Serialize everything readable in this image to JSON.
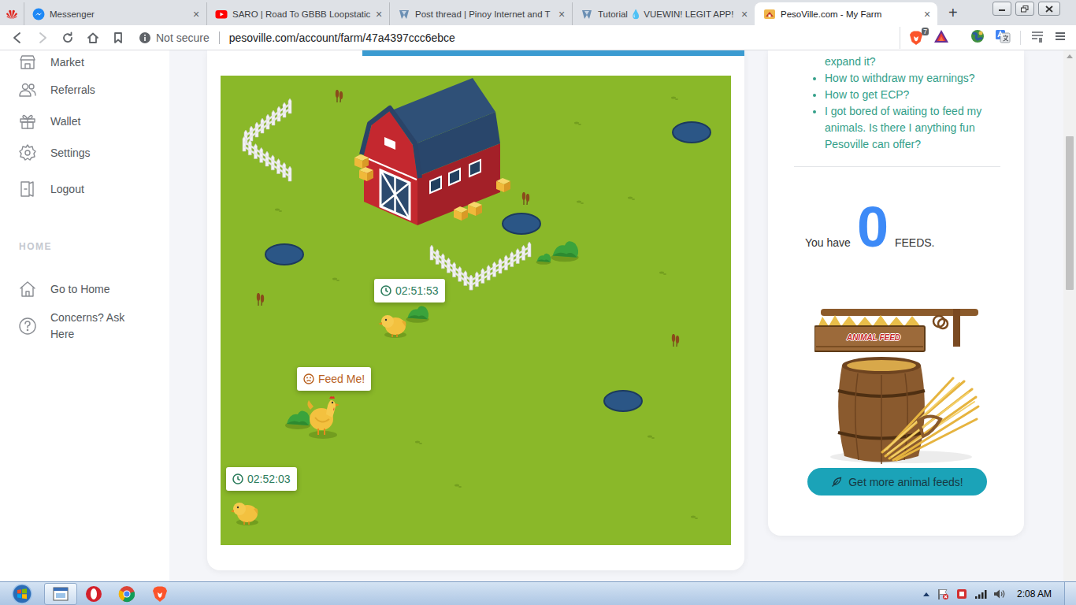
{
  "browser": {
    "tabs": [
      {
        "label": "Messenger",
        "selected": false
      },
      {
        "label": "SARO | Road To GBBB Loopstatic",
        "selected": false
      },
      {
        "label": "Post thread | Pinoy Internet and T",
        "selected": false
      },
      {
        "label": "Tutorial 💧 VUEWIN! LEGIT APP!",
        "selected": false
      },
      {
        "label": "PesoVille.com - My Farm",
        "selected": true
      }
    ],
    "tab_close": "×",
    "new_tab": "+",
    "security": "Not secure",
    "url": "pesoville.com/account/farm/47a4397ccc6ebce",
    "extension_badge": "7"
  },
  "sidebar": {
    "items": [
      "Market",
      "Referrals",
      "Wallet",
      "Settings",
      "Logout"
    ],
    "section": "HOME",
    "home_items": [
      "Go to Home",
      "Concerns? Ask Here"
    ]
  },
  "farm": {
    "animals": [
      {
        "kind": "chick",
        "hungry": false,
        "label": "02:51:53"
      },
      {
        "kind": "hen",
        "hungry": true,
        "label": "Feed Me!"
      },
      {
        "kind": "chick",
        "hungry": false,
        "label": "02:52:03"
      }
    ]
  },
  "help": {
    "cut_line": "expand it?",
    "links": [
      "How to withdraw my earnings?",
      "How to get ECP?",
      "I got bored of waiting to feed my animals. Is there I anything fun Pesoville can offer?"
    ]
  },
  "feeds": {
    "prefix": "You have",
    "count": "0",
    "suffix": "FEEDS."
  },
  "feed_sign": "ANIMAL FEED",
  "feed_button": "Get more animal feeds!",
  "taskbar": {
    "clock": "2:08 AM"
  }
}
